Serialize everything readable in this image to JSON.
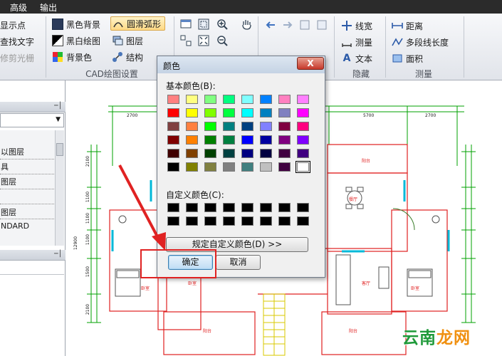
{
  "menu": {
    "items": [
      "高级",
      "输出"
    ]
  },
  "ribbon": {
    "left_partial": [
      "显示点",
      "查找文字",
      "修剪光栅"
    ],
    "cad_group": {
      "buttons": [
        "黑色背景",
        "圆滑弧形",
        "黑白绘图",
        "图层",
        "背景色",
        "结构"
      ],
      "label": "CAD绘图设置"
    },
    "hide_group": {
      "buttons": [
        "线宽",
        "测量",
        "文本"
      ],
      "label": "隐藏"
    },
    "measure_group": {
      "buttons": [
        "距离",
        "多段线长度",
        "面积"
      ],
      "label": "测量"
    },
    "accent": "#d9a74a"
  },
  "layer_panel": {
    "items": [
      "以图层",
      "具",
      "图层",
      "图层",
      "NDARD"
    ]
  },
  "canvas": {
    "dims_top": [
      "2700",
      "5700",
      "2700"
    ],
    "dims_side": [
      "2100",
      "1100",
      "1100",
      "1100",
      "12900",
      "1500",
      "2100"
    ],
    "rooms": [
      "阳台",
      "餐厅",
      "卧室",
      "卧室",
      "客厅",
      "卧室",
      "阳台",
      "阳台"
    ],
    "wall_color": "#e02020",
    "dim_color": "#00a000"
  },
  "color_dialog": {
    "title": "颜色",
    "close_label": "X",
    "basic_label": "基本颜色(B):",
    "basic_colors": [
      [
        "#ff8080",
        "#ffff80",
        "#80ff80",
        "#00ff80",
        "#80ffff",
        "#0080ff",
        "#ff80c0",
        "#ff80ff"
      ],
      [
        "#ff0000",
        "#ffff00",
        "#80ff00",
        "#00ff40",
        "#00ffff",
        "#0080c0",
        "#8080c0",
        "#ff00ff"
      ],
      [
        "#804040",
        "#ff8040",
        "#00ff00",
        "#008080",
        "#004080",
        "#8080ff",
        "#800040",
        "#ff0080"
      ],
      [
        "#800000",
        "#ff8000",
        "#008000",
        "#008040",
        "#0000ff",
        "#0000a0",
        "#800080",
        "#8000ff"
      ],
      [
        "#400000",
        "#804000",
        "#004000",
        "#004040",
        "#000080",
        "#000040",
        "#400040",
        "#400080"
      ],
      [
        "#000000",
        "#808000",
        "#808040",
        "#808080",
        "#408080",
        "#c0c0c0",
        "#400040",
        "#ffffff"
      ]
    ],
    "custom_label": "自定义颜色(C):",
    "custom_colors": [
      [
        "#000000",
        "#000000",
        "#000000",
        "#000000",
        "#000000",
        "#000000",
        "#000000",
        "#000000"
      ],
      [
        "#000000",
        "#000000",
        "#000000",
        "#000000",
        "#000000",
        "#000000",
        "#000000",
        "#000000"
      ]
    ],
    "define_custom_label": "规定自定义颜色(D) >>",
    "ok_label": "确定",
    "cancel_label": "取消"
  },
  "annotation": {
    "color": "#e02222"
  },
  "watermark": {
    "text_a": "云南",
    "text_b": "龙网"
  }
}
